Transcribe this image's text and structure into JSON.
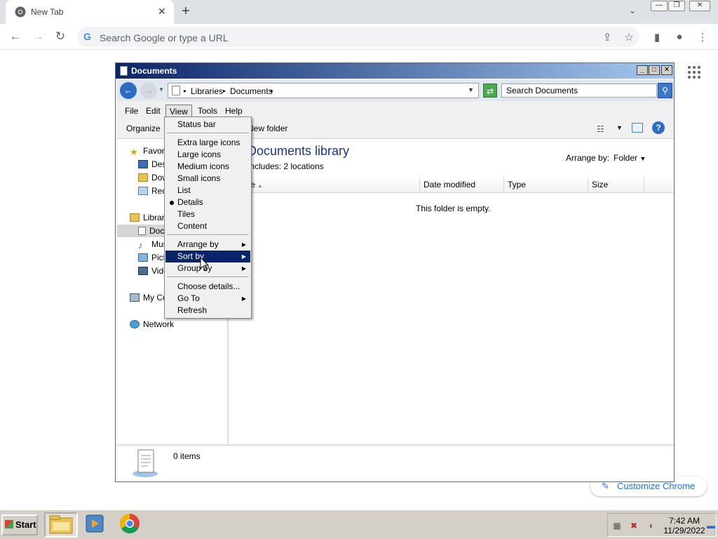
{
  "browser": {
    "tab_title": "New Tab",
    "omnibox_placeholder": "Search Google or type a URL",
    "customize_label": "Customize Chrome"
  },
  "explorer": {
    "window_title": "Documents",
    "breadcrumb": [
      "Libraries",
      "Documents"
    ],
    "search_placeholder": "Search Documents",
    "menu": [
      "File",
      "Edit",
      "View",
      "Tools",
      "Help"
    ],
    "commands": {
      "organize": "Organize",
      "new_folder": "New folder"
    },
    "nav": {
      "favorites": "Favorites",
      "desktop": "Desktop",
      "downloads": "Downloads",
      "recent": "Recent Places",
      "libraries": "Libraries",
      "documents": "Documents",
      "music": "Music",
      "pictures": "Pictures",
      "videos": "Videos",
      "computer": "My Computer",
      "network": "Network"
    },
    "library": {
      "title": "Documents library",
      "includes_prefix": "Includes: ",
      "includes_link": "2 locations",
      "arrange_label": "Arrange by:",
      "arrange_value": "Folder"
    },
    "columns": [
      "Name",
      "Date modified",
      "Type",
      "Size"
    ],
    "empty_message": "This folder is empty.",
    "item_count": "0 items"
  },
  "view_menu": {
    "items": [
      {
        "label": "Status bar"
      },
      {
        "label": "Extra large icons"
      },
      {
        "label": "Large icons"
      },
      {
        "label": "Medium icons"
      },
      {
        "label": "Small icons"
      },
      {
        "label": "List"
      },
      {
        "label": "Details",
        "checked": true
      },
      {
        "label": "Tiles"
      },
      {
        "label": "Content"
      },
      {
        "label": "Arrange by",
        "submenu": true
      },
      {
        "label": "Sort by",
        "submenu": true,
        "highlighted": true
      },
      {
        "label": "Group by",
        "submenu": true
      },
      {
        "label": "Choose details..."
      },
      {
        "label": "Go To",
        "submenu": true
      },
      {
        "label": "Refresh"
      }
    ]
  },
  "taskbar": {
    "start_label": "Start",
    "time": "7:42 AM",
    "date": "11/29/2022"
  },
  "colors": {
    "menu_highlight": "#0a246a",
    "library_title": "#1e3287",
    "chrome_accent": "#1a73e8"
  }
}
